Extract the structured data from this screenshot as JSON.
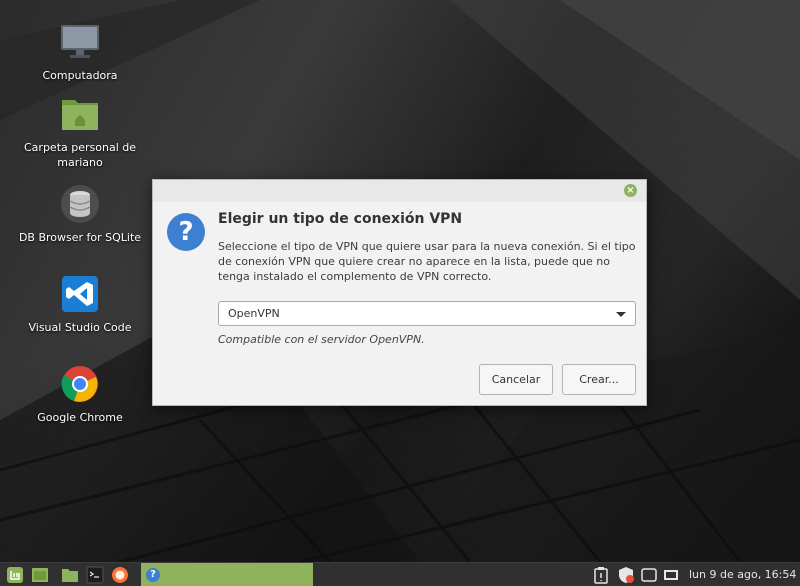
{
  "desktop": {
    "icons": [
      {
        "label": "Computadora",
        "icon": "computer-icon"
      },
      {
        "label": "Carpeta personal de mariano",
        "icon": "home-folder-icon"
      },
      {
        "label": "DB Browser for SQLite",
        "icon": "database-icon"
      },
      {
        "label": "Visual Studio Code",
        "icon": "vscode-icon"
      },
      {
        "label": "Google Chrome",
        "icon": "chrome-icon"
      }
    ]
  },
  "dialog": {
    "title": "Elegir un tipo de conexión VPN",
    "description": "Seleccione el tipo de VPN que quiere usar para la nueva conexión. Si el tipo de conexión VPN que quiere crear no aparece en la lista, puede que no tenga instalado el complemento de VPN correcto.",
    "vpn_type_selected": "OpenVPN",
    "compatibility_note": "Compatible con el servidor OpenVPN.",
    "cancel_label": "Cancelar",
    "create_label": "Crear...",
    "close_glyph": "×"
  },
  "taskbar": {
    "clock": "lun  9 de ago, 16:54",
    "launchers": [
      "mint-menu-icon",
      "show-desktop-icon",
      "files-icon",
      "terminal-icon",
      "firefox-icon"
    ],
    "tray": [
      "clipboard-icon",
      "shield-icon",
      "display-icon",
      "network-icon",
      "volume-icon"
    ],
    "active_window_icon": "question-icon",
    "accent_color": "#8fb35d"
  }
}
